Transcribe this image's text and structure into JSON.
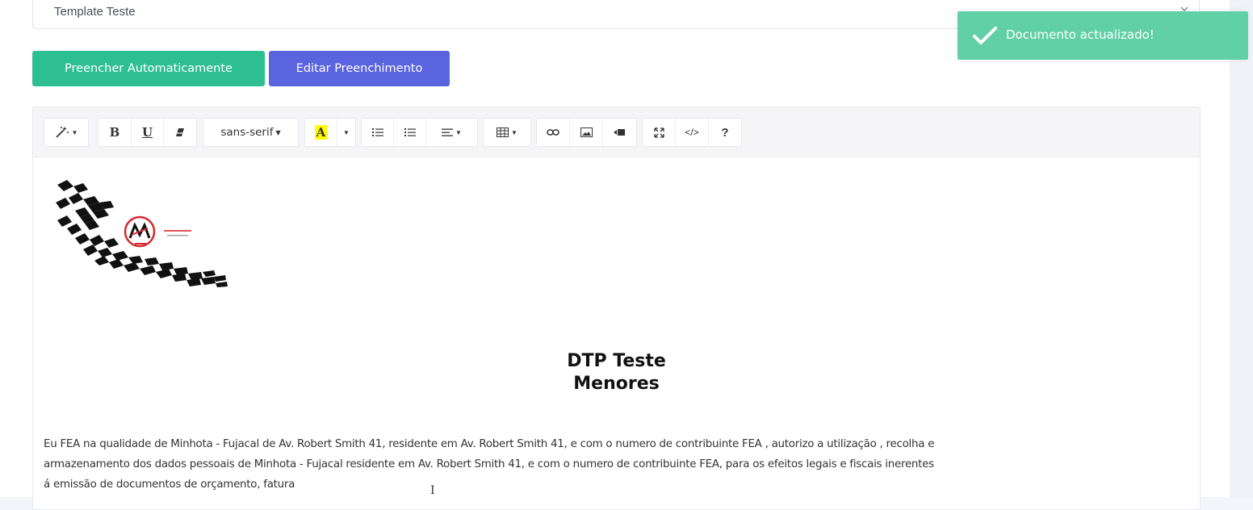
{
  "form": {
    "template_select": {
      "value": "Template Teste"
    }
  },
  "buttons": {
    "auto_fill": "Preencher Automaticamente",
    "edit_fill": "Editar Preenchimento"
  },
  "toast": {
    "message": "Documento actualizado!",
    "icon": "checkmark-icon",
    "color": "#5ccfa5"
  },
  "toolbar": {
    "font_family": "sans-serif",
    "icons": [
      "magic-wand-icon",
      "bold-icon",
      "underline-icon",
      "eraser-icon",
      "font-color-icon",
      "unordered-list-icon",
      "ordered-list-icon",
      "align-icon",
      "table-icon",
      "link-icon",
      "image-icon",
      "video-icon",
      "fullscreen-icon",
      "code-view-icon",
      "help-icon"
    ],
    "bold_label": "B",
    "underline_label": "U",
    "color_label": "A",
    "code_label": "</>",
    "help_label": "?"
  },
  "document": {
    "title_line1": "DTP Teste",
    "title_line2": "Menores",
    "body_lines": [
      "Eu FEA na qualidade de Minhota - Fujacal de Av. Robert Smith 41, residente em Av. Robert Smith 41, e com o numero de contribuinte FEA , autorizo a utilização , recolha e",
      "armazenamento dos dados pessoais de Minhota - Fujacal residente em Av. Robert Smith 41, e com o numero de contribuinte FEA, para os efeitos legais e fiscais inerentes",
      "á emissão de documentos de orçamento, fatura"
    ]
  },
  "colors": {
    "primary_green": "#2ebf91",
    "primary_indigo": "#5b64df",
    "logo_red": "#d9272e"
  }
}
